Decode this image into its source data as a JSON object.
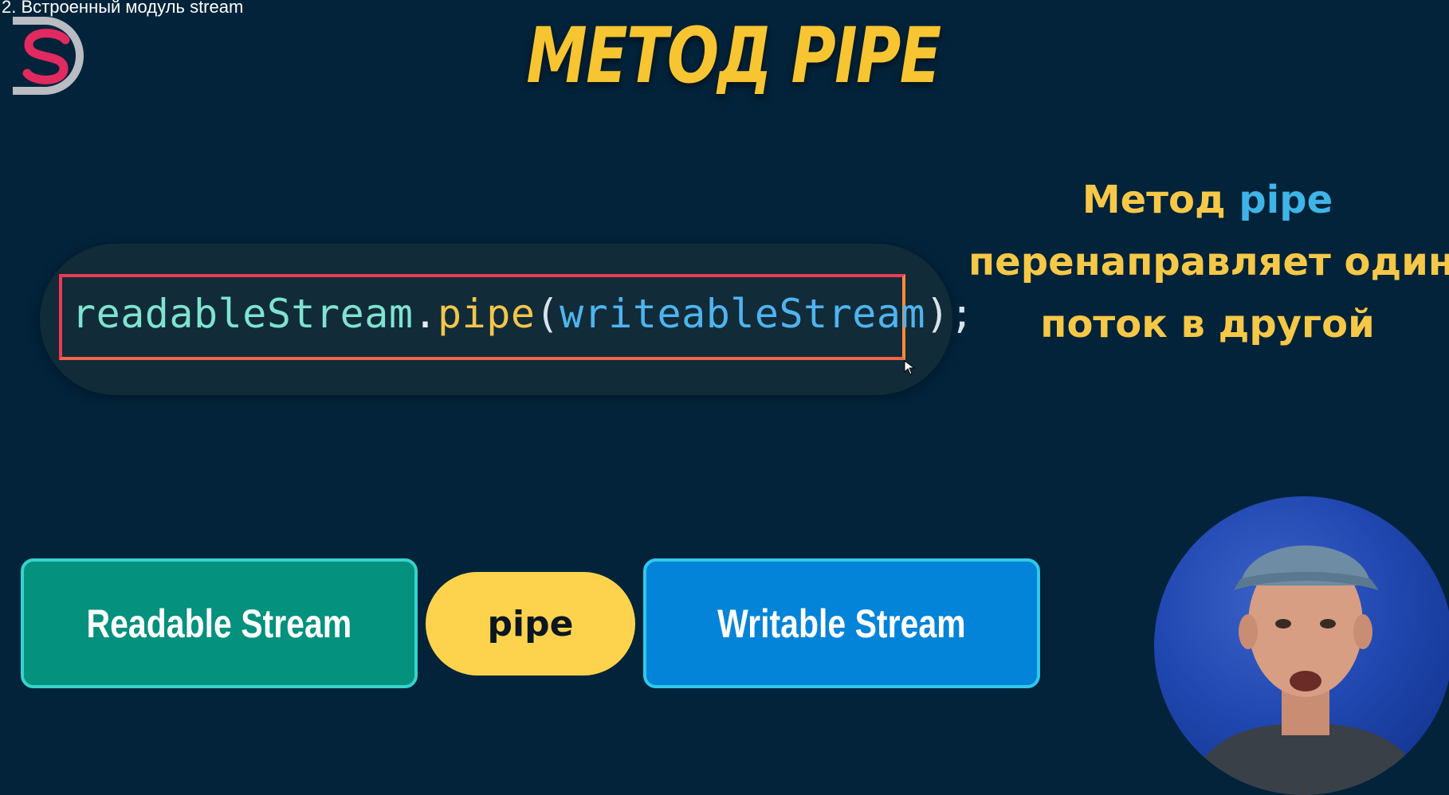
{
  "video": {
    "title": "2. Встроенный модуль stream"
  },
  "slide": {
    "title": "МЕТОД PIPE",
    "code": {
      "object": "readableStream",
      "dot": ".",
      "method": "pipe",
      "open_paren": "(",
      "argument": "writeableStream",
      "close_paren": ")",
      "semicolon": ";"
    },
    "description": {
      "line1_prefix": "Метод ",
      "line1_accent": "pipe",
      "line2": "перенаправляет один",
      "line3": "поток в другой"
    },
    "diagram": {
      "readable_label": "Readable Stream",
      "pipe_label": "pipe",
      "writable_label": "Writable Stream"
    }
  },
  "colors": {
    "background": "#02233a",
    "title": "#f7c531",
    "accent": "#3fb4e6",
    "readable_box": "#04917d",
    "pipe_pill": "#fdd34e",
    "writable_box": "#0484d8",
    "highlight_border": "#ee3a55"
  },
  "icons": [
    "channel-logo-icon",
    "mouse-cursor-icon"
  ]
}
